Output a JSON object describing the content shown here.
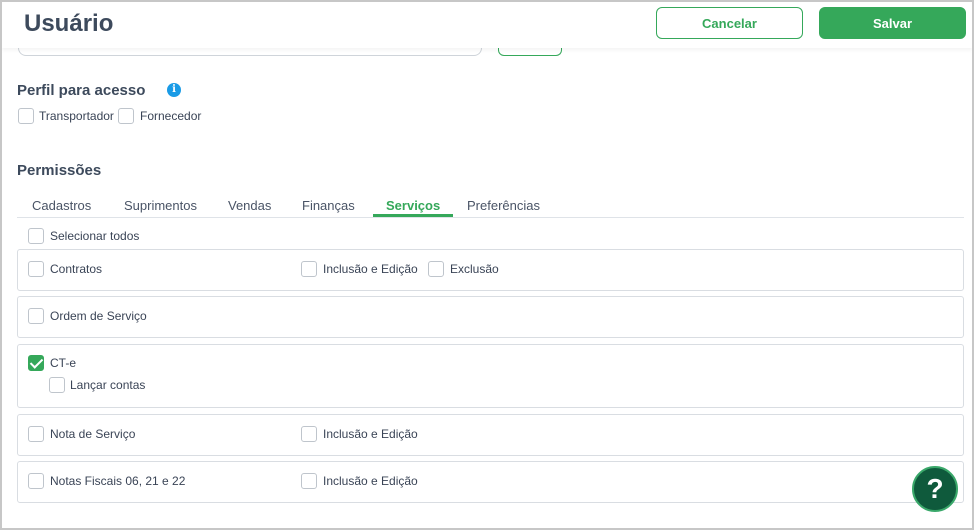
{
  "header": {
    "title": "Usuário",
    "cancel_label": "Cancelar",
    "save_label": "Salvar"
  },
  "perfil": {
    "title": "Perfil para acesso",
    "info_icon": "i",
    "options": [
      {
        "label": "Transportador",
        "checked": false
      },
      {
        "label": "Fornecedor",
        "checked": false
      }
    ]
  },
  "permissoes": {
    "title": "Permissões",
    "tabs": [
      "Cadastros",
      "Suprimentos",
      "Vendas",
      "Finanças",
      "Serviços",
      "Preferências"
    ],
    "active_tab": "Serviços",
    "select_all": "Selecionar todos",
    "rows": [
      {
        "label": "Contratos",
        "checked": false,
        "sub1": "Inclusão e Edição",
        "sub2": "Exclusão"
      },
      {
        "label": "Ordem de Serviço",
        "checked": false
      },
      {
        "label": "CT-e",
        "checked": true,
        "child": "Lançar contas"
      },
      {
        "label": "Nota de Serviço",
        "checked": false,
        "sub1": "Inclusão e Edição"
      },
      {
        "label": "Notas Fiscais 06, 21 e 22",
        "checked": false,
        "sub1": "Inclusão e Edição"
      }
    ]
  },
  "help": {
    "label": "?"
  },
  "colors": {
    "accent": "#35a85a",
    "info": "#1a9be6",
    "help_bg": "#0f5a3c"
  }
}
